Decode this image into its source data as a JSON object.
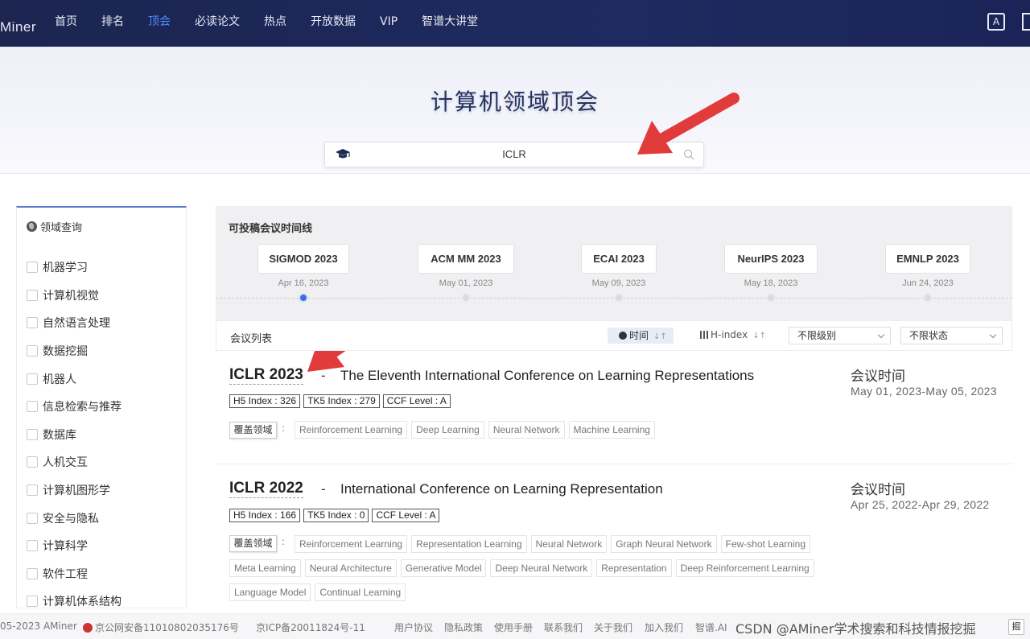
{
  "nav": {
    "logo": "Miner",
    "items": [
      {
        "label": "首页",
        "active": false
      },
      {
        "label": "排名",
        "active": false
      },
      {
        "label": "顶会",
        "active": true
      },
      {
        "label": "必读论文",
        "active": false
      },
      {
        "label": "热点",
        "active": false
      },
      {
        "label": "开放数据",
        "active": false
      },
      {
        "label": "VIP",
        "active": false
      },
      {
        "label": "智谱大讲堂",
        "active": false
      }
    ],
    "lang_icon": "A"
  },
  "hero": {
    "title": "计算机领域顶会",
    "search_value": "ICLR"
  },
  "sidebar": {
    "header": "领域查询",
    "categories": [
      "机器学习",
      "计算机视觉",
      "自然语言处理",
      "数据挖掘",
      "机器人",
      "信息检索与推荐",
      "数据库",
      "人机交互",
      "计算机图形学",
      "安全与隐私",
      "计算科学",
      "软件工程",
      "计算机体系结构"
    ]
  },
  "timeline": {
    "title": "可投稿会议时间线",
    "events": [
      {
        "name": "SIGMOD 2023",
        "date": "Apr 16, 2023",
        "active": true
      },
      {
        "name": "ACM MM 2023",
        "date": "May 01, 2023",
        "active": false
      },
      {
        "name": "ECAI 2023",
        "date": "May 09, 2023",
        "active": false
      },
      {
        "name": "NeurIPS 2023",
        "date": "May 18, 2023",
        "active": false
      },
      {
        "name": "EMNLP 2023",
        "date": "Jun 24, 2023",
        "active": false
      }
    ]
  },
  "list_bar": {
    "title": "会议列表",
    "sort_time": "时间",
    "sort_hindex": "H-index",
    "level_select": "不限级别",
    "status_select": "不限状态"
  },
  "conferences": [
    {
      "short": "ICLR 2023",
      "dash": "-",
      "full": "The Eleventh International Conference on Learning Representations",
      "badges": [
        "H5 Index : 326",
        "TK5 Index : 279",
        "CCF Level : A"
      ],
      "cover_label": "覆盖领域",
      "colon": ":",
      "tags": [
        "Reinforcement Learning",
        "Deep Learning",
        "Neural Network",
        "Machine Learning"
      ],
      "time_label": "会议时间",
      "time_value": "May 01, 2023-May 05, 2023"
    },
    {
      "short": "ICLR 2022",
      "dash": "-",
      "full": "International Conference on Learning Representation",
      "badges": [
        "H5 Index : 166",
        "TK5 Index : 0",
        "CCF Level : A"
      ],
      "cover_label": "覆盖领域",
      "colon": ":",
      "tags": [
        "Reinforcement Learning",
        "Representation Learning",
        "Neural Network",
        "Graph Neural Network",
        "Few-shot Learning",
        "Meta Learning",
        "Neural Architecture",
        "Generative Model",
        "Deep Neural Network",
        "Representation",
        "Deep Reinforcement Learning",
        "Language Model",
        "Continual Learning"
      ],
      "time_label": "会议时间",
      "time_value": "Apr 25, 2022-Apr 29, 2022"
    }
  ],
  "footer": {
    "copyright": "05-2023 AMiner",
    "police_record": "京公网安备11010802035176号",
    "icp": "京ICP备20011824号-11",
    "links": [
      "用户协议",
      "隐私政策",
      "使用手册",
      "联系我们",
      "关于我们",
      "加入我们",
      "智谱.AI"
    ],
    "watermark": "CSDN @AMiner学术搜索和科技情报挖掘",
    "edge_button": "掘"
  },
  "colors": {
    "nav_bg": "#1c2550",
    "accent": "#4a8cff",
    "timeline_active": "#3a6fe0",
    "arrow": "#e23b3b"
  }
}
